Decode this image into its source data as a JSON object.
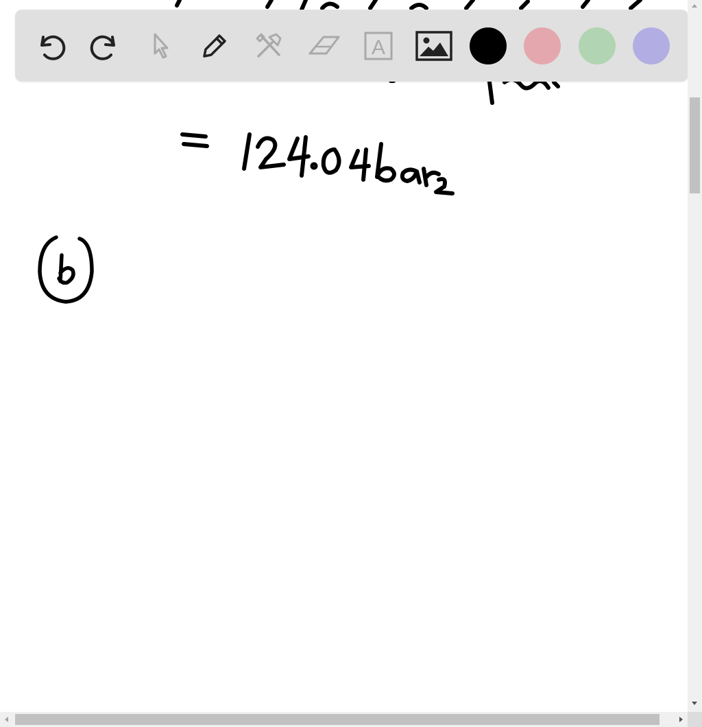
{
  "toolbar": {
    "tools": [
      {
        "id": "undo",
        "icon": "undo-icon",
        "enabled": true
      },
      {
        "id": "redo",
        "icon": "redo-icon",
        "enabled": true
      },
      {
        "id": "select",
        "icon": "cursor-arrow-icon",
        "enabled": false
      },
      {
        "id": "pen",
        "icon": "pencil-icon",
        "enabled": true
      },
      {
        "id": "tools",
        "icon": "crossed-tools-icon",
        "enabled": false
      },
      {
        "id": "eraser",
        "icon": "eraser-icon",
        "enabled": false
      },
      {
        "id": "text",
        "icon": "text-box-icon",
        "enabled": false,
        "glyph": "A"
      },
      {
        "id": "image",
        "icon": "image-icon",
        "enabled": true
      }
    ],
    "colors": [
      {
        "name": "black",
        "hex": "#000000",
        "selected": true
      },
      {
        "name": "red",
        "hex": "#e4a7ae",
        "selected": false
      },
      {
        "name": "green",
        "hex": "#b1d4b2",
        "selected": false
      },
      {
        "name": "purple",
        "hex": "#b2aee3",
        "selected": false
      }
    ]
  },
  "canvas": {
    "handwriting": [
      {
        "id": "result-line",
        "text": "= 124.04 bar"
      },
      {
        "id": "part-label",
        "text": "(b)"
      }
    ]
  }
}
